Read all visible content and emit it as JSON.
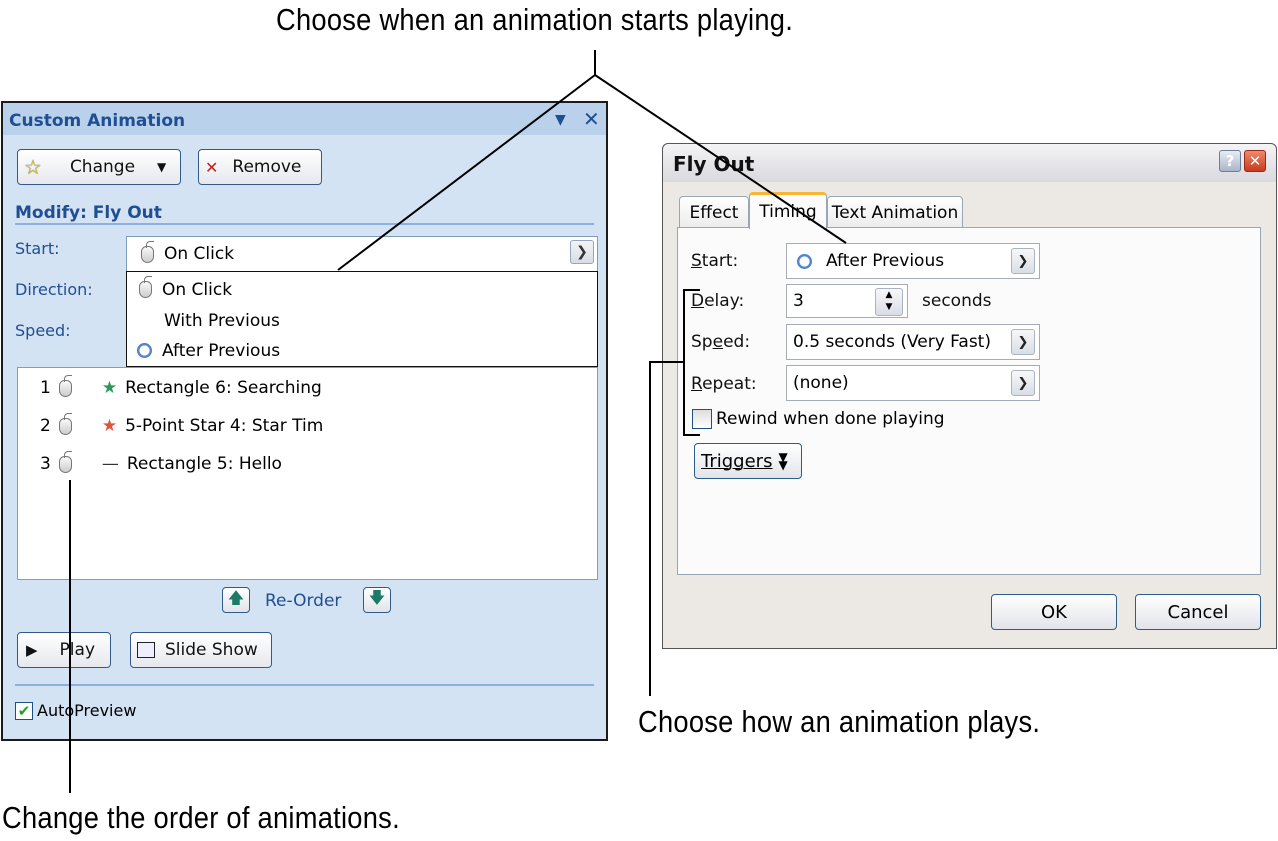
{
  "callouts": {
    "start": "Choose when an animation starts playing.",
    "plays": "Choose how an animation plays.",
    "order": "Change the order of animations."
  },
  "pane": {
    "title": "Custom Animation",
    "change_label": "Change",
    "remove_label": "Remove",
    "modify_heading": "Modify: Fly Out",
    "start_label": "Start:",
    "direction_label": "Direction:",
    "speed_label": "Speed:",
    "start_value": "On Click",
    "start_options": [
      {
        "label": "On Click",
        "icon": "mouse-icon"
      },
      {
        "label": "With Previous",
        "icon": ""
      },
      {
        "label": "After Previous",
        "icon": "clock-icon"
      }
    ],
    "animations": [
      {
        "order": "1",
        "trigger": "mouse-icon",
        "effect": "green-stars-icon",
        "name": "Rectangle 6: Searching"
      },
      {
        "order": "2",
        "trigger": "mouse-icon",
        "effect": "red-stars-icon",
        "name": "5-Point Star 4: Star Tim"
      },
      {
        "order": "3",
        "trigger": "mouse-icon",
        "effect": "line-path-icon",
        "name": "Rectangle 5: Hello"
      }
    ],
    "reorder_label": "Re-Order",
    "play_label": "Play",
    "slideshow_label": "Slide Show",
    "autopreview_label": "AutoPreview",
    "autopreview_checked": true
  },
  "dialog": {
    "title": "Fly Out",
    "tabs": [
      "Effect",
      "Timing",
      "Text Animation"
    ],
    "active_tab": "Timing",
    "start_label": "Start:",
    "start_value": "After Previous",
    "delay_label": "Delay:",
    "delay_value": "3",
    "delay_unit": "seconds",
    "speed_label": "Speed:",
    "speed_value": "0.5 seconds (Very Fast)",
    "repeat_label": "Repeat:",
    "repeat_value": "(none)",
    "rewind_label": "Rewind when done playing",
    "rewind_checked": false,
    "triggers_label": "Triggers",
    "ok_label": "OK",
    "cancel_label": "Cancel"
  },
  "colors": {
    "pane_bg": "#d4e3f4",
    "pane_title": "#1f4e93",
    "active_tab_accent": "#f6b736",
    "close_red": "#d9412c"
  }
}
